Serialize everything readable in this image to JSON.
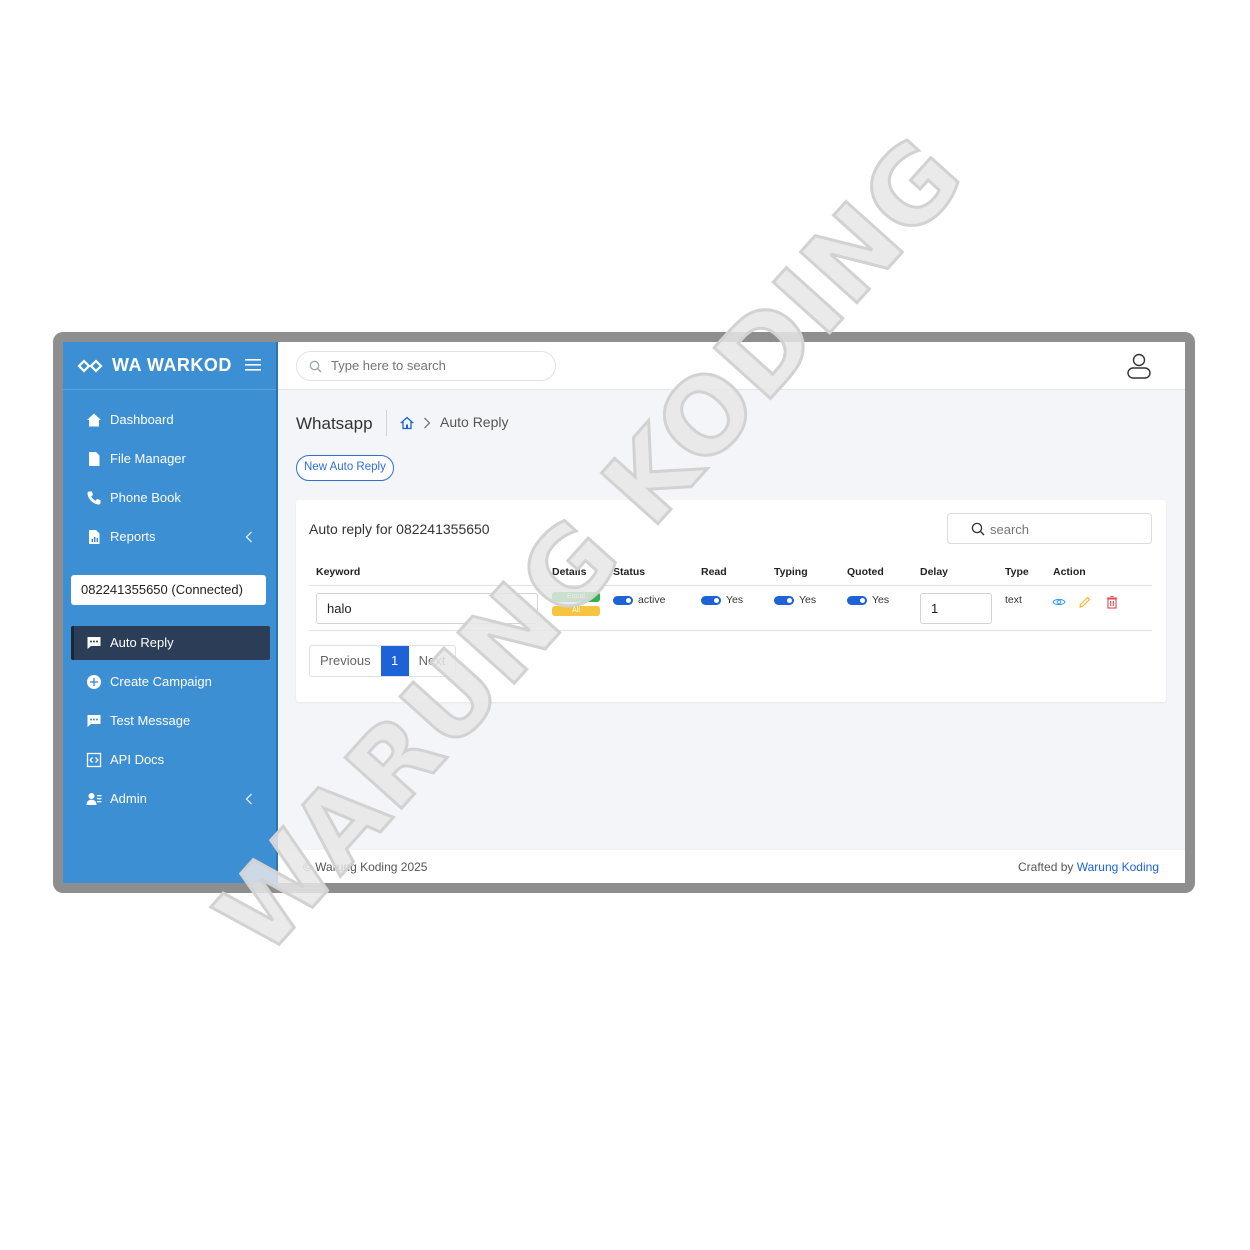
{
  "app": {
    "brand": "WA WARKOD"
  },
  "sidebar": {
    "items": [
      {
        "label": "Dashboard",
        "icon": "home-icon"
      },
      {
        "label": "File Manager",
        "icon": "file-icon"
      },
      {
        "label": "Phone Book",
        "icon": "phone-icon"
      },
      {
        "label": "Reports",
        "icon": "report-icon"
      }
    ],
    "device": "082241355650 (Connected)",
    "items2": [
      {
        "label": "Auto Reply",
        "icon": "chat-icon"
      },
      {
        "label": "Create Campaign",
        "icon": "plus-circle-icon"
      },
      {
        "label": "Test Message",
        "icon": "message-icon"
      },
      {
        "label": "API Docs",
        "icon": "code-icon"
      },
      {
        "label": "Admin",
        "icon": "users-icon"
      }
    ]
  },
  "topbar": {
    "search_placeholder": "Type here to search"
  },
  "page": {
    "title": "Whatsapp",
    "breadcrumb": "Auto Reply",
    "new_button": "New Auto Reply"
  },
  "card": {
    "title": "Auto reply for 082241355650",
    "search_placeholder": "search",
    "columns": [
      "Keyword",
      "Details",
      "Status",
      "Read",
      "Typing",
      "Quoted",
      "Delay",
      "Type",
      "Action"
    ],
    "row": {
      "keyword": "halo",
      "details": [
        "Equal",
        "All"
      ],
      "status": "active",
      "read": "Yes",
      "typing": "Yes",
      "quoted": "Yes",
      "delay": "1",
      "type": "text"
    },
    "pagination": {
      "prev": "Previous",
      "current": "1",
      "next": "Next"
    }
  },
  "footer": {
    "copyright": "© Warung Koding 2025",
    "crafted": "Crafted by",
    "crafted_link": "Warung Koding"
  },
  "watermark": "WARUNG KODING",
  "colors": {
    "sidebar": "#3d8fd4",
    "active": "#2c3e57",
    "accent": "#1d62d6"
  }
}
